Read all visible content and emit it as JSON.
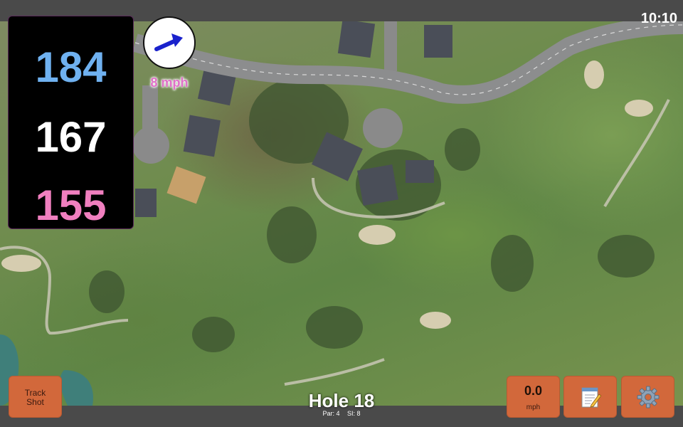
{
  "status": {
    "time": "10:10"
  },
  "yardages": {
    "back": "184",
    "middle": "167",
    "front": "155"
  },
  "wind": {
    "speed_label": "8 mph",
    "arrow_icon": "wind-arrow-icon",
    "arrow_color": "#1a22cc"
  },
  "buttons": {
    "track_shot_line1": "Track",
    "track_shot_line2": "Shot",
    "speed_value": "0.0",
    "speed_unit": "mph",
    "notes_icon": "notepad-icon",
    "settings_icon": "gear-icon"
  },
  "hole": {
    "title": "Hole 18",
    "par": "Par: 4",
    "si": "SI: 8"
  },
  "colors": {
    "button_bg": "#d2683b",
    "back_yardage": "#6fb1f0",
    "front_yardage": "#f07fbf",
    "wind_label": "#e070c8"
  }
}
